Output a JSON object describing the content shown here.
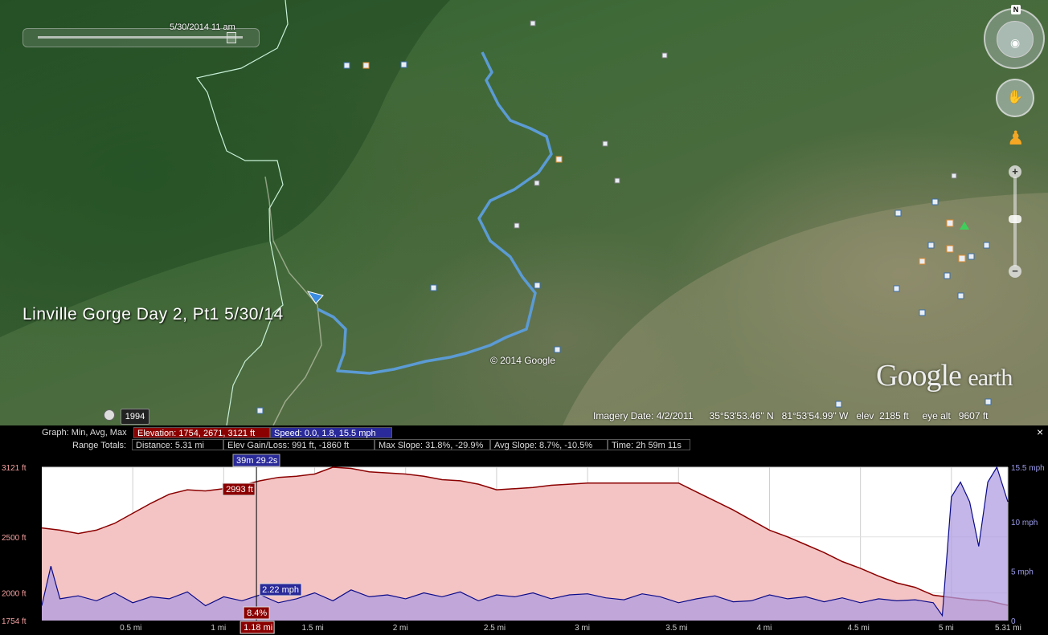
{
  "map": {
    "time_slider_label": "5/30/2014  11 am",
    "tour_title": "Linville Gorge Day 2, Pt1 5/30/14",
    "copyright": "© 2014 Google",
    "brand_google": "Google",
    "brand_earth": "earth",
    "historical_year": "1994",
    "status": {
      "imagery_date": "Imagery Date: 4/2/2011",
      "lat": "35°53'53.46\" N",
      "lon": "81°53'54.99\" W",
      "elev": "elev  2185 ft",
      "eye_alt": "eye alt   9607 ft"
    },
    "compass_north": "N",
    "icons": [
      "compass-icon",
      "eye-icon",
      "hand-icon",
      "pegman-icon",
      "zoom-in-icon",
      "zoom-out-icon",
      "clock-icon",
      "direction-arrow-icon"
    ],
    "colors": {
      "track": "#5b9bd5",
      "trail": "#c8f0d8"
    }
  },
  "elevation_panel": {
    "graph_label": "Graph:",
    "graph_modes": "Min, Avg, Max",
    "elevation_box": "Elevation: 1754, 2671, 3121 ft",
    "speed_box": "Speed: 0.0, 1.8, 15.5 mph",
    "range_totals_label": "Range Totals:",
    "distance_box": "Distance: 5.31 mi",
    "gain_loss_box": "Elev Gain/Loss: 991 ft, -1860 ft",
    "max_slope_box": "Max Slope: 31.8%, -29.9%",
    "avg_slope_box": "Avg Slope: 8.7%, -10.5%",
    "time_box": "Time: 2h 59m 11s",
    "cursor_time": "39m 29.2s",
    "cursor_elev": "2993 ft",
    "cursor_speed": "2.22 mph",
    "cursor_slope": "8.4%",
    "cursor_distance": "1.18 mi",
    "close": "×",
    "colors": {
      "elevation_fill": "#f4c4c4",
      "elevation_line": "#8b0000",
      "speed_fill": "#b09ee0",
      "speed_line": "#0a0a8a",
      "highlight_red": "#8b0000",
      "highlight_blue": "#2a2a9a"
    }
  },
  "chart_data": {
    "type": "area",
    "left_axis_ticks": [
      "3121 ft",
      "2500 ft",
      "2000 ft",
      "1754 ft"
    ],
    "right_axis_ticks": [
      "15.5 mph",
      "10 mph",
      "5 mph",
      "0"
    ],
    "x_ticks": [
      "0.5 mi",
      "1 mi",
      "1.5 mi",
      "2 mi",
      "2.5 mi",
      "3 mi",
      "3.5 mi",
      "4 mi",
      "4.5 mi",
      "5 mi",
      "5.31 mi"
    ],
    "x_range": [
      0,
      5.31
    ],
    "elev_range": [
      1754,
      3121
    ],
    "speed_range": [
      0,
      15.5
    ],
    "series": [
      {
        "name": "Elevation",
        "x": [
          0,
          0.1,
          0.2,
          0.3,
          0.4,
          0.5,
          0.6,
          0.7,
          0.8,
          0.9,
          1.0,
          1.1,
          1.2,
          1.3,
          1.4,
          1.5,
          1.6,
          1.7,
          1.8,
          1.9,
          2.0,
          2.1,
          2.2,
          2.3,
          2.4,
          2.5,
          2.6,
          2.7,
          2.8,
          2.9,
          3.0,
          3.1,
          3.2,
          3.3,
          3.4,
          3.5,
          3.6,
          3.7,
          3.8,
          3.9,
          4.0,
          4.1,
          4.2,
          4.3,
          4.4,
          4.5,
          4.6,
          4.7,
          4.8,
          4.9,
          5.0,
          5.1,
          5.2,
          5.31
        ],
        "y": [
          2580,
          2560,
          2530,
          2560,
          2620,
          2710,
          2800,
          2880,
          2920,
          2910,
          2930,
          2960,
          3000,
          3030,
          3040,
          3060,
          3121,
          3110,
          3080,
          3070,
          3060,
          3040,
          3010,
          3000,
          2970,
          2920,
          2930,
          2940,
          2960,
          2970,
          2980,
          2980,
          2980,
          2980,
          2980,
          2980,
          2900,
          2820,
          2740,
          2650,
          2560,
          2500,
          2430,
          2360,
          2280,
          2220,
          2150,
          2090,
          2050,
          1980,
          1960,
          1940,
          1930,
          1890
        ]
      },
      {
        "name": "Speed",
        "x": [
          0,
          0.05,
          0.1,
          0.2,
          0.3,
          0.4,
          0.5,
          0.6,
          0.7,
          0.8,
          0.9,
          1.0,
          1.1,
          1.2,
          1.3,
          1.4,
          1.5,
          1.6,
          1.7,
          1.8,
          1.9,
          2.0,
          2.1,
          2.2,
          2.3,
          2.4,
          2.5,
          2.6,
          2.7,
          2.8,
          2.9,
          3.0,
          3.1,
          3.2,
          3.3,
          3.4,
          3.5,
          3.6,
          3.7,
          3.8,
          3.9,
          4.0,
          4.1,
          4.2,
          4.3,
          4.4,
          4.5,
          4.6,
          4.7,
          4.8,
          4.9,
          4.95,
          5.0,
          5.05,
          5.1,
          5.15,
          5.2,
          5.25,
          5.31
        ],
        "y": [
          1.5,
          5.5,
          2.2,
          2.5,
          2.0,
          2.8,
          1.8,
          2.4,
          2.2,
          2.9,
          1.5,
          2.4,
          2.0,
          2.6,
          1.8,
          2.2,
          2.8,
          2.0,
          3.1,
          2.4,
          2.6,
          2.2,
          2.8,
          2.4,
          2.9,
          2.0,
          2.6,
          2.4,
          2.8,
          2.2,
          2.6,
          2.7,
          2.3,
          2.1,
          2.7,
          2.4,
          1.8,
          2.2,
          2.5,
          1.9,
          2.0,
          2.6,
          2.2,
          2.4,
          1.9,
          2.3,
          1.8,
          2.2,
          2.0,
          2.1,
          1.8,
          0.5,
          12.5,
          14,
          12,
          7.5,
          14,
          15.5,
          12
        ]
      }
    ],
    "cursor_x": 1.18
  }
}
